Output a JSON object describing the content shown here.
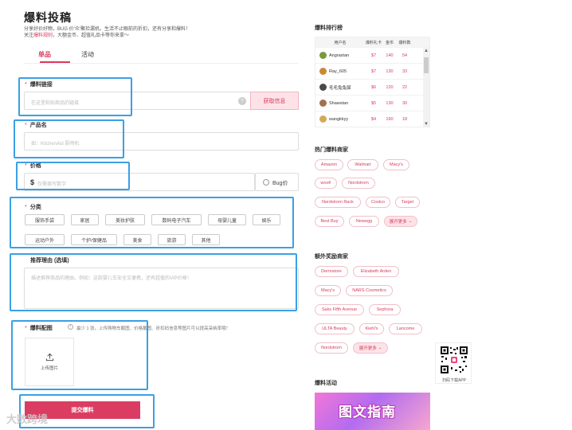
{
  "page": {
    "title": "爆料投稿",
    "desc_line1": "分享好价好物，BUG 价'众'聚捡漏机。生活不止眼前的折扣，还有分享和爆料！",
    "desc_line2_prefix": "关注",
    "desc_link": "爆料规则",
    "desc_line2_suffix": "，大额金币、超值礼品卡等你来拿～"
  },
  "tabs": [
    {
      "label": "单品"
    },
    {
      "label": "活动"
    }
  ],
  "form": {
    "link": {
      "label": "爆料链接",
      "placeholder": "在这里粘贴商品的链接",
      "help": "?",
      "fetch_label": "获取信息"
    },
    "product": {
      "label": "产品名",
      "placeholder": "如：KitchenAid 厨师机"
    },
    "price": {
      "label": "价格",
      "currency": "$",
      "placeholder": "仅需填写数字",
      "bug_label": "Bug价"
    },
    "category": {
      "label": "分类",
      "items": [
        "服饰手袋",
        "家居",
        "美妆护肤",
        "数码电子汽车",
        "母婴儿童",
        "娱乐",
        "运动户外",
        "个护/保健品",
        "美食",
        "旅游",
        "其他"
      ]
    },
    "reason": {
      "label": "推荐理由 (选填)",
      "placeholder": "描述推荐商品的理由。例如：这款婴儿车安全又便携，还有超值的VIP价格！"
    },
    "images": {
      "label": "爆料配图",
      "hint": "最少 1 张。上传购物车截图、价格截图、折扣码信息等图片可以提高采纳率哦！",
      "upload_label": "上传图片"
    },
    "submit_label": "提交爆料"
  },
  "watermark": "大数跨境",
  "sidebar": {
    "rank": {
      "title": "爆料排行榜",
      "headers": [
        "用户名",
        "爆料礼卡",
        "金币",
        "爆料数"
      ],
      "rows": [
        {
          "name": "Angrastan",
          "card": "$7",
          "coins": "140",
          "count": "54",
          "avatar": "#7a9a3a"
        },
        {
          "name": "Ray_605",
          "card": "$7",
          "coins": "130",
          "count": "33",
          "avatar": "#c9893a"
        },
        {
          "name": "毛毛兔兔屎",
          "card": "$6",
          "coins": "120",
          "count": "22",
          "avatar": "#4a4a4a"
        },
        {
          "name": "Shawstan",
          "card": "$5",
          "coins": "130",
          "count": "30",
          "avatar": "#a07050"
        },
        {
          "name": "wangkkyy",
          "card": "$4",
          "coins": "160",
          "count": "18",
          "avatar": "#d4a85a"
        }
      ]
    },
    "hot_merchants": {
      "title": "热门爆料商家",
      "items": [
        "Amazon",
        "Walmart",
        "Macy's",
        "woot!",
        "Nordstrom",
        "Nordstrom Rack",
        "Costco",
        "Target",
        "Best Buy",
        "Newegg"
      ],
      "more_label": "展开更多"
    },
    "extra_merchants": {
      "title": "额外奖励商家",
      "items": [
        "Dermstore",
        "Elizabeth Arden",
        "Macy's",
        "NARS Cosmetics",
        "Saks Fifth Avenue",
        "Sephora",
        "ULTA Beauty",
        "Kiehl's",
        "Lancome",
        "Nordstrom"
      ],
      "more_label": "展开更多"
    },
    "qr_label": "扫码下载APP",
    "activity": {
      "title": "爆料活动",
      "banner_text": "图文指南"
    }
  }
}
